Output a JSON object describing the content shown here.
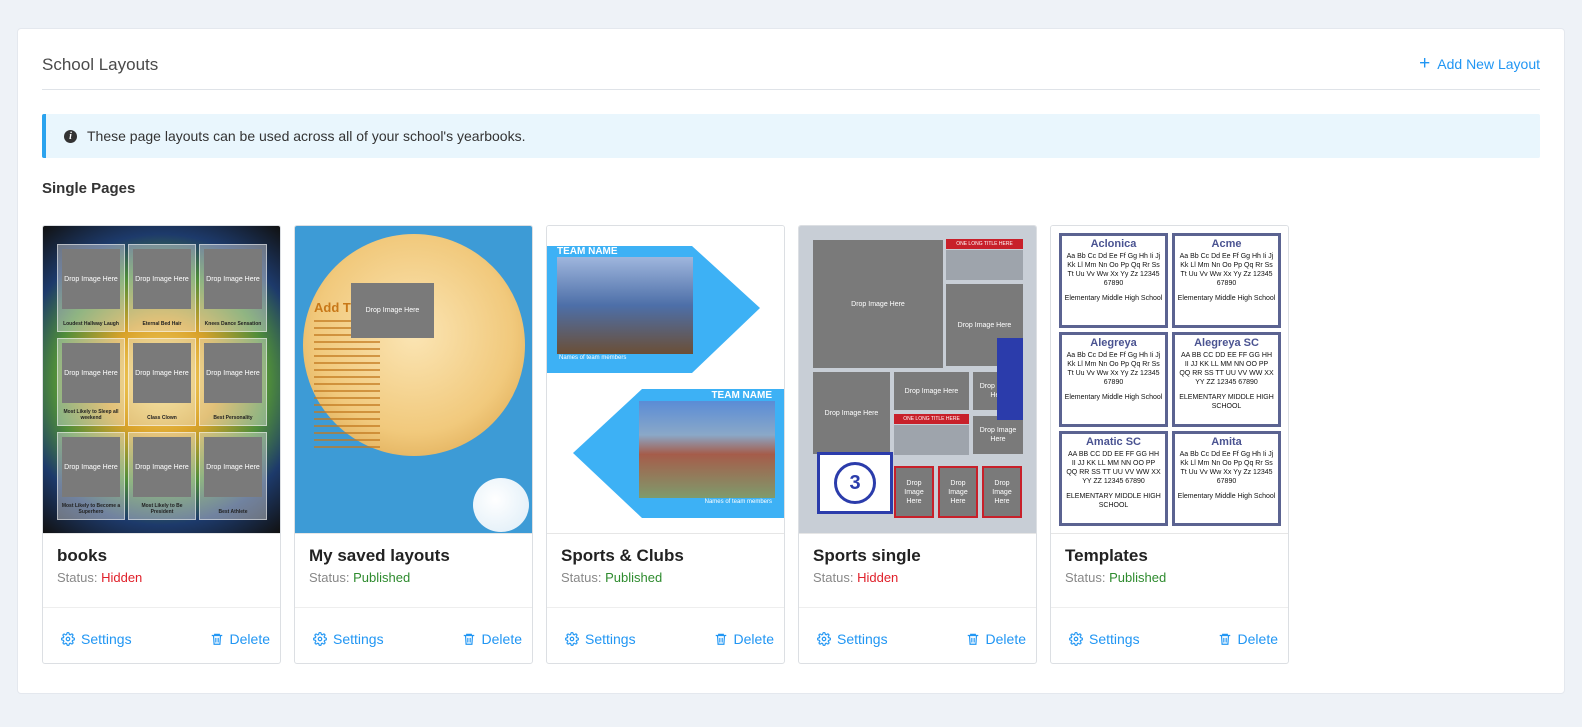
{
  "header": {
    "title": "School Layouts",
    "add_label": "Add New Layout"
  },
  "info": {
    "text": "These page layouts can be used across all of your school's yearbooks."
  },
  "section_title": "Single Pages",
  "status_prefix": "Status:",
  "drop_text": "Drop Image Here",
  "cards": [
    {
      "title": "books",
      "status": "Hidden",
      "settings": "Settings",
      "delete": "Delete"
    },
    {
      "title": "My saved layouts",
      "status": "Published",
      "settings": "Settings",
      "delete": "Delete"
    },
    {
      "title": "Sports & Clubs",
      "status": "Published",
      "settings": "Settings",
      "delete": "Delete"
    },
    {
      "title": "Sports single",
      "status": "Hidden",
      "settings": "Settings",
      "delete": "Delete"
    },
    {
      "title": "Templates",
      "status": "Published",
      "settings": "Settings",
      "delete": "Delete"
    }
  ],
  "thumb_books": {
    "captions": [
      "Loudest Hallway Laugh",
      "Eternal Bed Hair",
      "Knees Dance Sensation",
      "Most Likely to Sleep all weekend",
      "Class Clown",
      "Best Personality",
      "Most Likely to Become a Superhero",
      "Most Likely to Be President",
      "Best Athlete"
    ]
  },
  "thumb_saved": {
    "heading": "Add Ti"
  },
  "thumb_sports": {
    "team_name": "TEAM NAME",
    "members": "Names of team members"
  },
  "thumb_single": {
    "long_title": "ONE LONG TITLE HERE",
    "number": "3"
  },
  "thumb_templates": {
    "fonts": [
      {
        "name": "Aclonica",
        "sample": "Aa Bb Cc Dd Ee Ff Gg Hh Ii Jj Kk Ll Mm Nn Oo Pp Qq Rr Ss Tt Uu Vv Ww Xx Yy Zz 12345 67890",
        "school": "Elementary Middle High School"
      },
      {
        "name": "Acme",
        "sample": "Aa Bb Cc Dd Ee Ff Gg Hh Ii Jj Kk Ll Mm Nn Oo Pp Qq Rr Ss Tt Uu Vv Ww Xx Yy Zz 12345 67890",
        "school": "Elementary Middle High School"
      },
      {
        "name": "Alegreya",
        "sample": "Aa Bb Cc Dd Ee Ff Gg Hh Ii Jj Kk Ll Mm Nn Oo Pp Qq Rr Ss Tt Uu Vv Ww Xx Yy Zz 12345 67890",
        "school": "Elementary Middle High School"
      },
      {
        "name": "Alegreya SC",
        "sample": "AA BB CC DD EE FF GG HH II JJ KK LL MM NN OO PP QQ RR SS TT UU VV WW XX YY ZZ 12345 67890",
        "school": "ELEMENTARY MIDDLE HIGH SCHOOL"
      },
      {
        "name": "Amatic SC",
        "sample": "AA BB CC DD EE FF GG HH II JJ KK LL MM NN OO PP QQ RR SS TT UU VV WW XX YY ZZ 12345 67890",
        "school": "ELEMENTARY MIDDLE HIGH SCHOOL"
      },
      {
        "name": "Amita",
        "sample": "Aa Bb Cc Dd Ee Ff Gg Hh Ii Jj Kk Ll Mm Nn Oo Pp Qq Rr Ss Tt Uu Vv Ww Xx Yy Zz 12345 67890",
        "school": "Elementary Middle High School"
      }
    ]
  },
  "colors": {
    "accent": "#2196f3",
    "hidden": "#e0202a",
    "published": "#2e8b2e",
    "info_border": "#2ba3ee",
    "info_bg": "#e9f6fd"
  }
}
